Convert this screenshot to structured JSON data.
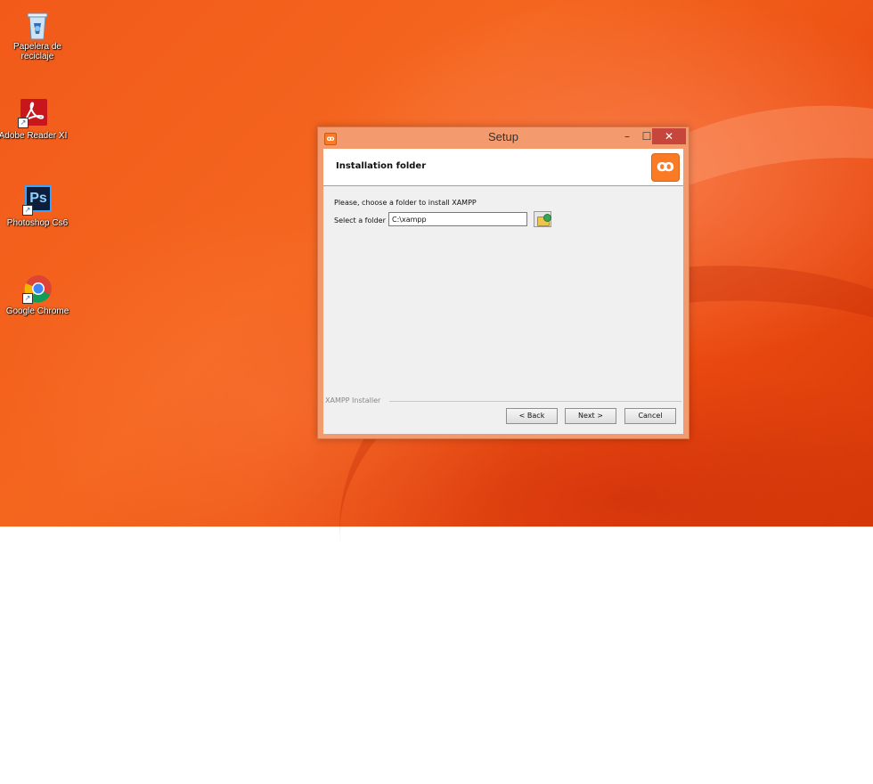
{
  "desktop": {
    "icons": [
      {
        "label_line1": "Papelera de",
        "label_line2": "reciclaje"
      },
      {
        "label_line1": "Adobe Reader XI",
        "label_line2": ""
      },
      {
        "label_line1": "Photoshop Cs6",
        "label_line2": ""
      },
      {
        "label_line1": "Google Chrome",
        "label_line2": ""
      }
    ],
    "ps_glyph": "Ps"
  },
  "window": {
    "title": "Setup",
    "app_icon_glyph": "ꝏ",
    "minimize_glyph": "–",
    "maximize_glyph": "☐",
    "close_glyph": "✕",
    "accent_color": "#fb7a24"
  },
  "installer": {
    "header_title": "Installation folder",
    "logo_glyph": "ꝏ",
    "prompt": "Please, choose a folder to install XAMPP",
    "select_label": "Select a folder",
    "folder_value": "C:\\xampp",
    "group_label": "XAMPP Installer",
    "buttons": {
      "back": "< Back",
      "next": "Next >",
      "cancel": "Cancel"
    }
  }
}
